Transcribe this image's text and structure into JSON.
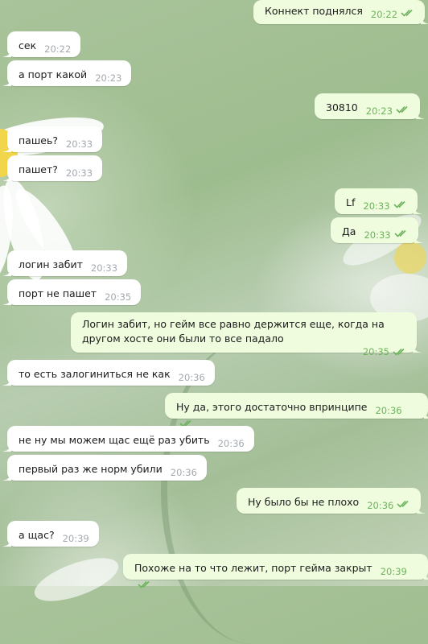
{
  "messages": [
    {
      "dir": "out",
      "text": "Коннект поднялся",
      "time": "20:22"
    },
    {
      "dir": "in",
      "text": "сек",
      "time": "20:22"
    },
    {
      "dir": "in",
      "text": "а порт какой",
      "time": "20:23"
    },
    {
      "dir": "out",
      "text": "30810",
      "time": "20:23"
    },
    {
      "dir": "in",
      "text": "пашеь?",
      "time": "20:33"
    },
    {
      "dir": "in",
      "text": "пашет?",
      "time": "20:33"
    },
    {
      "dir": "out",
      "text": "Lf",
      "time": "20:33"
    },
    {
      "dir": "out",
      "text": "Да",
      "time": "20:33"
    },
    {
      "dir": "in",
      "text": "логин забит",
      "time": "20:33"
    },
    {
      "dir": "in",
      "text": "порт не пашет",
      "time": "20:35"
    },
    {
      "dir": "out",
      "text": "Логин забит, но гейм все равно держится еще, когда на другом хосте они были то все падало",
      "time": "20:35"
    },
    {
      "dir": "in",
      "text": "то есть залогиниться не как",
      "time": "20:36"
    },
    {
      "dir": "out",
      "text": "Ну да, этого достаточно впринципе",
      "time": "20:36"
    },
    {
      "dir": "in",
      "text": "не ну мы можем щас ещё раз убить",
      "time": "20:36"
    },
    {
      "dir": "in",
      "text": "первый раз же норм убили",
      "time": "20:36"
    },
    {
      "dir": "out",
      "text": "Ну было бы не плохо",
      "time": "20:36"
    },
    {
      "dir": "in",
      "text": "а щас?",
      "time": "20:39"
    },
    {
      "dir": "out",
      "text": "Похоже на то что лежит, порт гейма закрыт",
      "time": "20:39"
    }
  ],
  "colors": {
    "incoming_bubble": "#ffffff",
    "outgoing_bubble": "#effdde",
    "read_ticks": "#6db35c",
    "timestamp_in": "#a3aab0",
    "flower_center": "#f1d54a"
  },
  "icons": {
    "read_receipt": "double-check-icon"
  }
}
